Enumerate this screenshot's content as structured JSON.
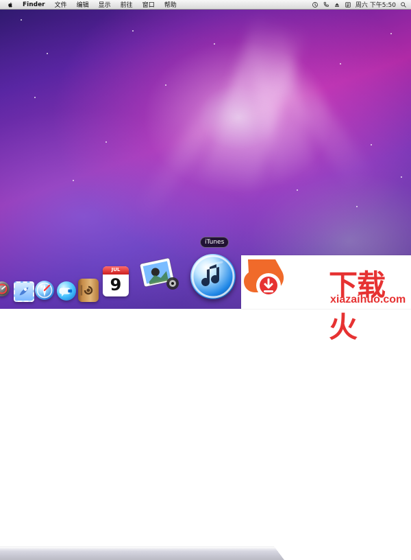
{
  "menubar": {
    "apple_icon": "apple-icon",
    "app_name": "Finder",
    "items": [
      "文件",
      "编辑",
      "显示",
      "前往",
      "窗口",
      "帮助"
    ],
    "status_icons": [
      "time-machine-icon",
      "phone-icon",
      "eject-icon",
      "input-method-icon"
    ],
    "clock": "周六 下午5:50",
    "search_icon": "spotlight-search-icon"
  },
  "tooltip": {
    "text": "iTunes"
  },
  "dock": {
    "items": [
      {
        "name": "dock-item-dashboard",
        "icon": "dashboard-icon"
      },
      {
        "name": "dock-item-mail",
        "icon": "mail-stamp-icon"
      },
      {
        "name": "dock-item-safari",
        "icon": "safari-compass-icon"
      },
      {
        "name": "dock-item-ichat",
        "icon": "ichat-video-icon"
      },
      {
        "name": "dock-item-address-book",
        "icon": "address-book-icon"
      },
      {
        "name": "dock-item-ical",
        "icon": "calendar-icon",
        "month": "JUL",
        "day": "9"
      },
      {
        "name": "dock-item-iphoto",
        "icon": "iphoto-icon"
      },
      {
        "name": "dock-item-itunes",
        "icon": "itunes-icon"
      }
    ]
  },
  "watermark": {
    "logo": "xiazaihuo-flame-logo",
    "title_cn": "下载火",
    "site": "xiazaihuo.com",
    "accent": "#e63232"
  }
}
